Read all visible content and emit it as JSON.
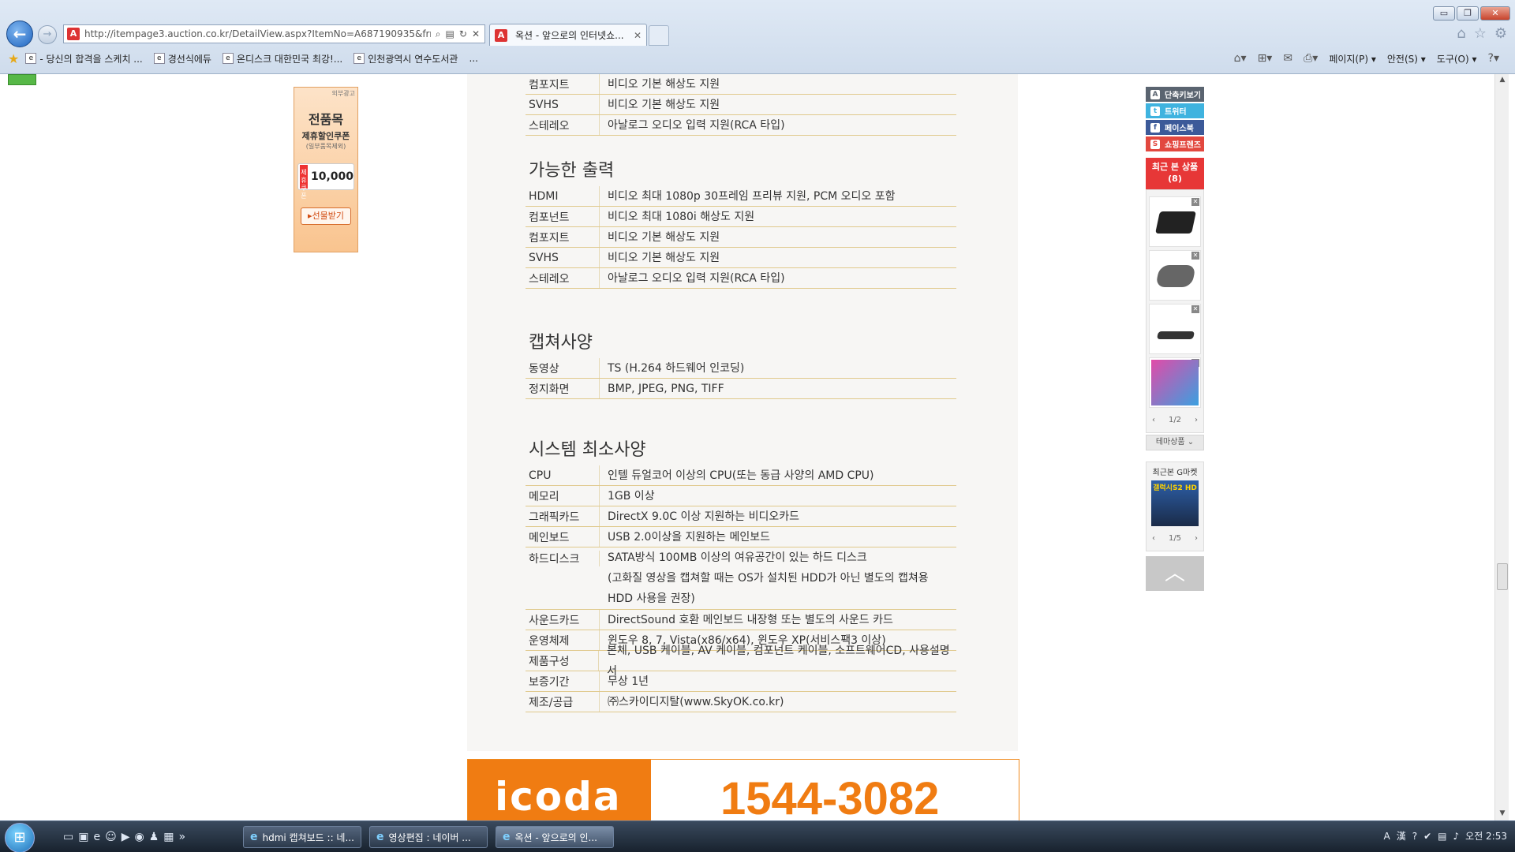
{
  "browser": {
    "url": "http://itempage3.auction.co.kr/DetailView.aspx?ItemNo=A687190935&frm3=\\",
    "tab_title": "옥션 - 앞으로의 인터넷쇼...",
    "window_buttons": [
      "▭",
      "❐",
      "✕"
    ],
    "favorites": [
      "- 당신의 합격을 스케치 ...",
      "경선식에듀",
      "온디스크  대한민국 최강!...",
      "인천광역시 연수도서관"
    ],
    "fav_more": "...",
    "commands": [
      "페이지(P)",
      "안전(S)",
      "도구(O)"
    ]
  },
  "left_ad": {
    "tag": "외부광고",
    "title": "전품목",
    "subtitle": "제휴할인쿠폰",
    "note": "(일부품목제외)",
    "coupon_tag": "제휴쿠폰",
    "coupon_value": "10,000",
    "button": "▸선물받기"
  },
  "sections": {
    "output_title": "가능한 출력",
    "capture_title": "캡쳐사양",
    "system_title": "시스템 최소사양"
  },
  "input_tail": [
    {
      "k": "컴포지트",
      "v": "비디오 기본 해상도 지원"
    },
    {
      "k": "SVHS",
      "v": "비디오 기본 해상도 지원"
    },
    {
      "k": "스테레오",
      "v": "아날로그 오디오 입력 지원(RCA 타입)"
    }
  ],
  "output": [
    {
      "k": "HDMI",
      "v": "비디오 최대 1080p 30프레임 프리뷰 지원, PCM 오디오 포함"
    },
    {
      "k": "컴포넌트",
      "v": "비디오 최대 1080i 해상도 지원"
    },
    {
      "k": "컴포지트",
      "v": "비디오 기본 해상도 지원"
    },
    {
      "k": "SVHS",
      "v": "비디오 기본 해상도 지원"
    },
    {
      "k": "스테레오",
      "v": "아날로그 오디오 입력 지원(RCA 타입)"
    }
  ],
  "capture": [
    {
      "k": "동영상",
      "v": "TS (H.264 하드웨어 인코딩)"
    },
    {
      "k": "정지화면",
      "v": "BMP, JPEG, PNG, TIFF"
    }
  ],
  "system": [
    {
      "k": "CPU",
      "v": "인텔 듀얼코어 이상의 CPU(또는 동급 사양의 AMD CPU)"
    },
    {
      "k": "메모리",
      "v": "1GB 이상"
    },
    {
      "k": "그래픽카드",
      "v": "DirectX 9.0C 이상 지원하는 비디오카드"
    },
    {
      "k": "메인보드",
      "v": "USB 2.0이상을 지원하는 메인보드"
    },
    {
      "k": "하드디스크",
      "v": "SATA방식 100MB 이상의 여유공간이 있는 하드 디스크\n(고화질 영상을 캡쳐할 때는 OS가 설치된 HDD가 아닌 별도의 캡쳐용\nHDD 사용을 권장)"
    },
    {
      "k": "사운드카드",
      "v": "DirectSound 호환 메인보드 내장형 또는 별도의 사운드 카드"
    },
    {
      "k": "운영체제",
      "v": "윈도우 8, 7, Vista(x86/x64), 윈도우 XP(서비스팩3 이상)"
    },
    {
      "k": "제품구성",
      "v": "본체, USB 케이블, AV 케이블, 컴포넌트 케이블, 소프트웨어CD, 사용설명서"
    },
    {
      "k": "보증기간",
      "v": "무상 1년"
    },
    {
      "k": "제조/공급",
      "v": "㈜스카이디지탈(www.SkyOK.co.kr)"
    }
  ],
  "banner": {
    "logo": "icoda",
    "phone": "1544-3082"
  },
  "sidebar": {
    "alt": "단축키보기",
    "twitter": "트위터",
    "facebook": "페이스북",
    "shopping": "쇼핑프렌즈",
    "recent_title": "최근 본 상품",
    "recent_count": "(8)",
    "recent_page": "1/2",
    "theme": "테마상품 ⌄",
    "gmarket_title": "최근본 G마켓",
    "gmarket_item": "갤럭시S2 HD",
    "gmarket_page": "1/5"
  },
  "taskbar": {
    "tasks": [
      "hdmi 캡쳐보드 :: 네...",
      "영상편집 : 네이버 ...",
      "옥션 - 앞으로의 인..."
    ],
    "clock": "오전 2:53"
  }
}
